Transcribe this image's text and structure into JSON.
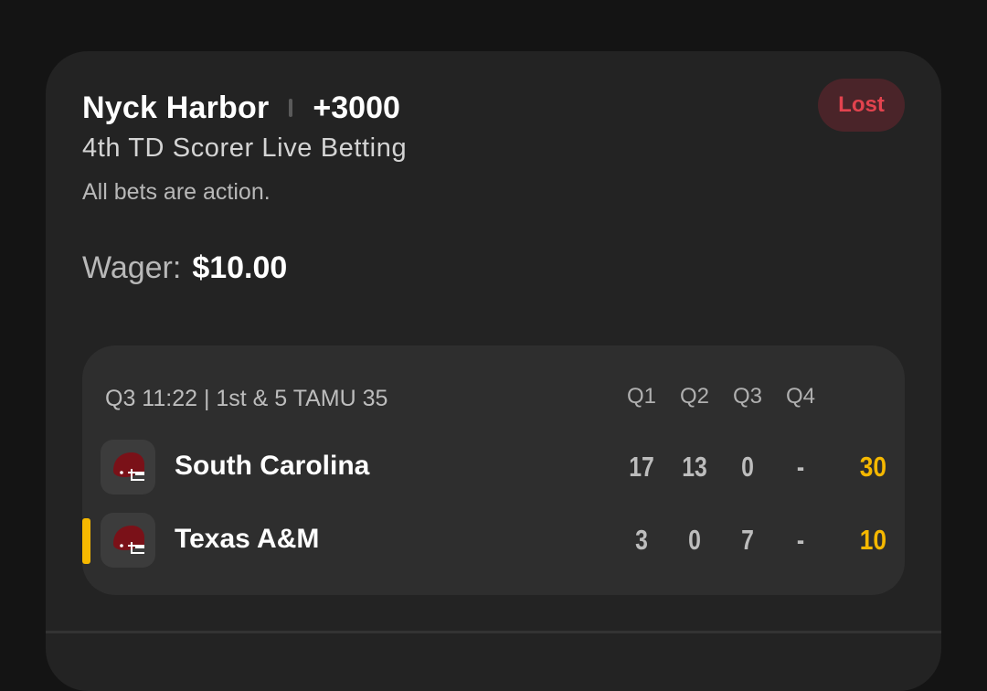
{
  "bet": {
    "selection": "Nyck Harbor",
    "odds": "+3000",
    "market": "4th TD Scorer Live Betting",
    "note": "All bets are action.",
    "status": "Lost",
    "wager_label": "Wager:",
    "wager_amount": "$10.00"
  },
  "game": {
    "status": "Q3 11:22 | 1st & 5 TAMU 35",
    "quarters": [
      "Q1",
      "Q2",
      "Q3",
      "Q4"
    ],
    "teams": [
      {
        "name": "South Carolina",
        "logo_icon": "football-helmet-icon",
        "scores": [
          "17",
          "13",
          "0",
          "-"
        ],
        "total": "30",
        "possession": false
      },
      {
        "name": "Texas A&M",
        "logo_icon": "football-helmet-icon",
        "scores": [
          "3",
          "0",
          "7",
          "-"
        ],
        "total": "10",
        "possession": true
      }
    ]
  },
  "colors": {
    "background": "#141414",
    "card": "#232323",
    "scoreboard": "#2e2e2e",
    "accent_total": "#f5b800",
    "lost_text": "#e2434e",
    "lost_badge": "#4a2429",
    "helmet": "#7a1118"
  }
}
